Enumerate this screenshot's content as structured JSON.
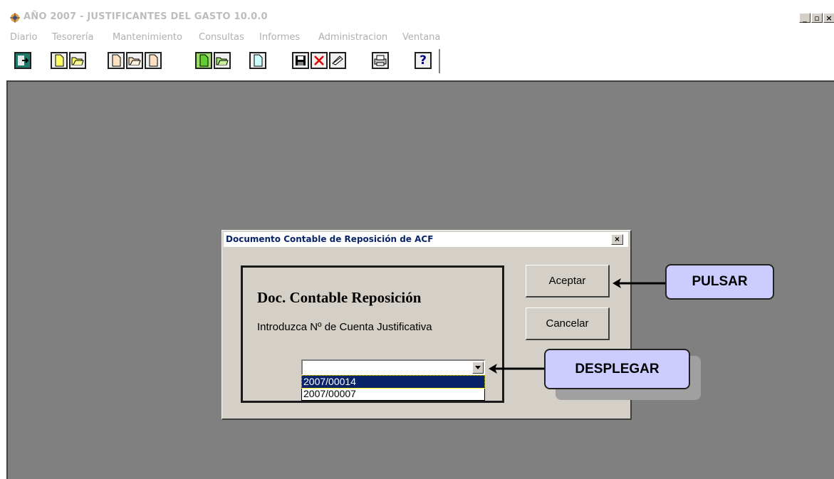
{
  "window": {
    "title": "AÑO 2007 - JUSTIFICANTES DEL GASTO 10.0.0",
    "controls": [
      "_",
      "▫",
      "×"
    ]
  },
  "menu": {
    "items": [
      "Diario",
      "Tesorería",
      "Mantenimiento",
      "Consultas",
      "Informes",
      "Administracion",
      "Ventana"
    ]
  },
  "toolbar": {
    "buttons": [
      {
        "icon": "exit-door-icon"
      },
      {
        "icon": "new-document-icon"
      },
      {
        "icon": "open-folder-icon"
      },
      {
        "icon": "new-document-icon"
      },
      {
        "icon": "open-folder-icon"
      },
      {
        "icon": "new-document-icon"
      },
      {
        "icon": "new-document-green-icon"
      },
      {
        "icon": "open-folder-icon"
      },
      {
        "icon": "new-document-icon"
      },
      {
        "icon": "save-disk-icon"
      },
      {
        "icon": "delete-x-icon"
      },
      {
        "icon": "edit-icon"
      },
      {
        "icon": "print-icon"
      },
      {
        "icon": "help-question-icon"
      }
    ],
    "help_label": "?"
  },
  "dialog": {
    "title": "Documento Contable de Reposición de ACF",
    "close_label": "×",
    "heading": "Doc. Contable Reposición",
    "prompt": "Introduzca Nº de Cuenta Justificativa",
    "combo_value": "",
    "options": [
      "2007/00014",
      "2007/00007"
    ],
    "selected_option": "2007/00014",
    "accept_label": "Aceptar",
    "cancel_label": "Cancelar"
  },
  "callouts": {
    "pulsar": "PULSAR",
    "desplegar": "DESPLEGAR"
  },
  "colors": {
    "mdi_background": "#808080",
    "dialog_face": "#d4d0c8",
    "selection": "#0a246a",
    "callout_fill": "#ccccff"
  }
}
